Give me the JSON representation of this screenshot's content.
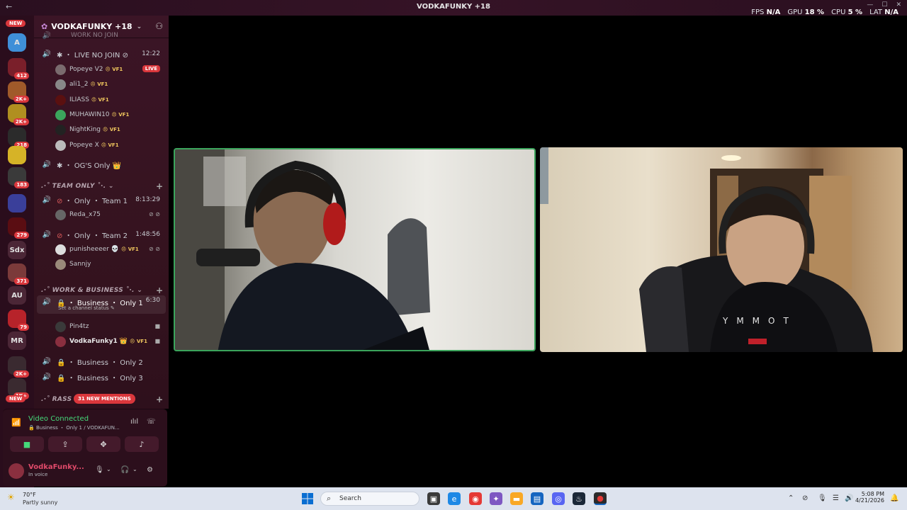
{
  "window": {
    "title": "VODKAFUNKY +18",
    "nav_back": "←",
    "nav_fwd": "→",
    "fps_label": "FPS",
    "fps_value": "N/A",
    "gpu_label": "GPU",
    "gpu_value": "18 %",
    "cpu_label": "CPU",
    "cpu_value": "5 %",
    "lat_label": "LAT",
    "lat_value": "N/A",
    "minimize": "—",
    "maximize": "☐",
    "close": "✕"
  },
  "rail": {
    "new_top": "NEW",
    "new_bottom": "NEW",
    "servers": [
      {
        "label": "A",
        "badge": ""
      },
      {
        "label": "",
        "badge": "412"
      },
      {
        "label": "",
        "badge": "2K+"
      },
      {
        "label": "",
        "badge": "2K+"
      },
      {
        "label": "",
        "badge": "218"
      },
      {
        "label": "",
        "badge": ""
      },
      {
        "label": "",
        "badge": "183"
      },
      {
        "label": "",
        "badge": ""
      },
      {
        "label": "",
        "badge": "279"
      },
      {
        "label": "Sdx",
        "badge": ""
      },
      {
        "label": "",
        "badge": "371"
      },
      {
        "label": "AU",
        "badge": ""
      },
      {
        "label": "",
        "badge": "79"
      },
      {
        "label": "MR",
        "badge": ""
      },
      {
        "label": "",
        "badge": "2K+"
      },
      {
        "label": "",
        "badge": "1K+"
      }
    ]
  },
  "sidebar": {
    "guild_name": "VODKAFUNKY +18",
    "clipped_top": "WORK NO JOIN",
    "live_no_join": {
      "label": "LIVE NO JOIN",
      "time": "12:22"
    },
    "live_users": [
      {
        "name": "Popeye V2",
        "tag": "VF1",
        "live": "LIVE"
      },
      {
        "name": "ali1_2",
        "tag": "VF1"
      },
      {
        "name": "ILIASS",
        "tag": "VF1"
      },
      {
        "name": "MUHAWIN10",
        "tag": "VF1"
      },
      {
        "name": "NightKing",
        "tag": "VF1"
      },
      {
        "name": "Popeye X",
        "tag": "VF1"
      }
    ],
    "og_only": "OG'S Only",
    "team_only": "TEAM ONLY",
    "team1": {
      "label": "Only ・ Team 1",
      "time": "8:13:29",
      "user": "Reda_x75"
    },
    "team2": {
      "label": "Only ・ Team 2",
      "time": "1:48:56",
      "user1": "punisheeeer",
      "user1_tag": "VF1",
      "user2": "Sannjy"
    },
    "work_business": "WORK & BUSINESS",
    "biz1": {
      "label": "Business ・ Only 1",
      "time": "6:30",
      "sub": "Set a channel status"
    },
    "biz1_users": [
      {
        "name": "Pin4tz"
      },
      {
        "name": "VodkaFunky1",
        "tag": "VF1"
      }
    ],
    "biz2": "Business ・ Only 2",
    "biz3": "Business ・ Only 3",
    "rass": "RASS",
    "mentions": "31 NEW MENTIONS"
  },
  "voice": {
    "status": "Video Connected",
    "channel": "Business ・ Only 1 / VODKAFUN..."
  },
  "me": {
    "name": "VodkaFunky...",
    "status": "In voice"
  },
  "taskbar": {
    "temp": "70°F",
    "condition": "Partly sunny",
    "search_placeholder": "Search",
    "time": "5:08 PM",
    "date": "4/21/2026"
  },
  "colors": {
    "accent_green": "#3ba55c",
    "live_red": "#da373c",
    "sidebar_bg": "#3b1526"
  }
}
